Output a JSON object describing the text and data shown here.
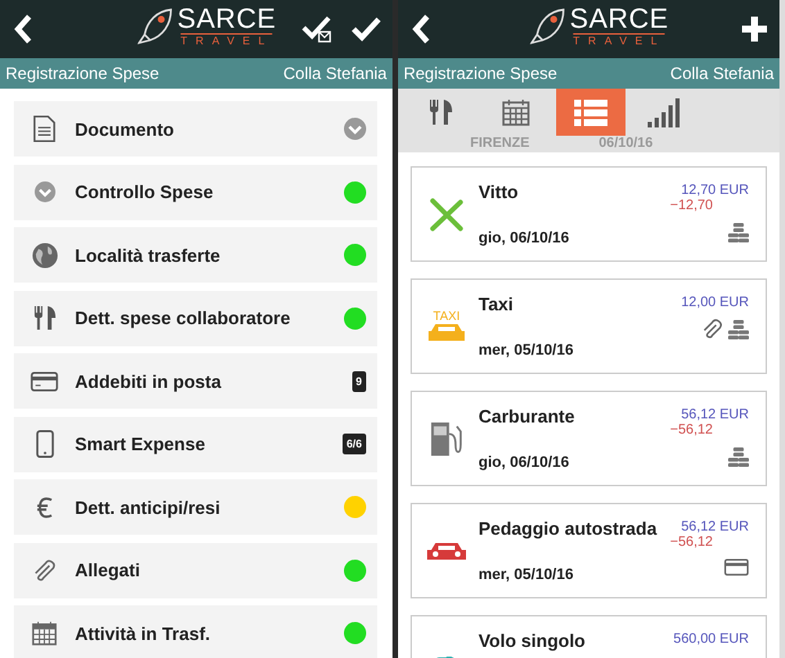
{
  "left_screen": {
    "header": {
      "logo_title": "SARCE",
      "logo_subtitle": "TRAVEL",
      "actions": [
        {
          "kind": "check-mail"
        },
        {
          "kind": "check"
        }
      ]
    },
    "subheader": {
      "title": "Registrazione Spese",
      "user": "Colla Stefania"
    },
    "menu": [
      {
        "label": "Documento",
        "status": {
          "kind": "chevron"
        }
      },
      {
        "label": "Controllo Spese",
        "status": {
          "kind": "dot",
          "color": "#22dd22"
        }
      },
      {
        "label": "Località trasferte",
        "status": {
          "kind": "dot",
          "color": "#22dd22"
        }
      },
      {
        "label": "Dett. spese collaboratore",
        "status": {
          "kind": "dot",
          "color": "#22dd22"
        }
      },
      {
        "label": "Addebiti in posta",
        "status": {
          "kind": "badge",
          "text": "9"
        }
      },
      {
        "label": "Smart Expense",
        "status": {
          "kind": "badge",
          "text": "6/6"
        }
      },
      {
        "label": "Dett. anticipi/resi",
        "status": {
          "kind": "dot",
          "color": "#ffd200"
        }
      },
      {
        "label": "Allegati",
        "status": {
          "kind": "dot",
          "color": "#22dd22"
        }
      },
      {
        "label": "Attività in Trasf.",
        "status": {
          "kind": "dot",
          "color": "#22dd22"
        }
      }
    ]
  },
  "right_screen": {
    "header": {
      "logo_title": "SARCE",
      "logo_subtitle": "TRAVEL",
      "actions": [
        {
          "kind": "plus"
        }
      ]
    },
    "subheader": {
      "title": "Registrazione Spese",
      "user": "Colla Stefania"
    },
    "tabs": [
      {
        "selected": false
      },
      {
        "selected": false
      },
      {
        "selected": true
      },
      {
        "selected": false
      }
    ],
    "caption": {
      "city": "FIRENZE",
      "date": "06/10/16"
    },
    "expenses": [
      {
        "title": "Vitto",
        "date": "gio, 06/10/16",
        "amount": "12,70 EUR",
        "refund": "−12,70"
      },
      {
        "title": "Taxi",
        "date": "mer, 05/10/16",
        "amount": "12,00 EUR",
        "icon_text": "TAXI"
      },
      {
        "title": "Carburante",
        "date": "gio, 06/10/16",
        "amount": "56,12 EUR",
        "refund": "−56,12"
      },
      {
        "title": "Pedaggio autostrada",
        "date": "mer, 05/10/16",
        "amount": "56,12 EUR",
        "refund": "−56,12"
      },
      {
        "title": "Volo singolo",
        "amount": "560,00 EUR"
      }
    ]
  }
}
